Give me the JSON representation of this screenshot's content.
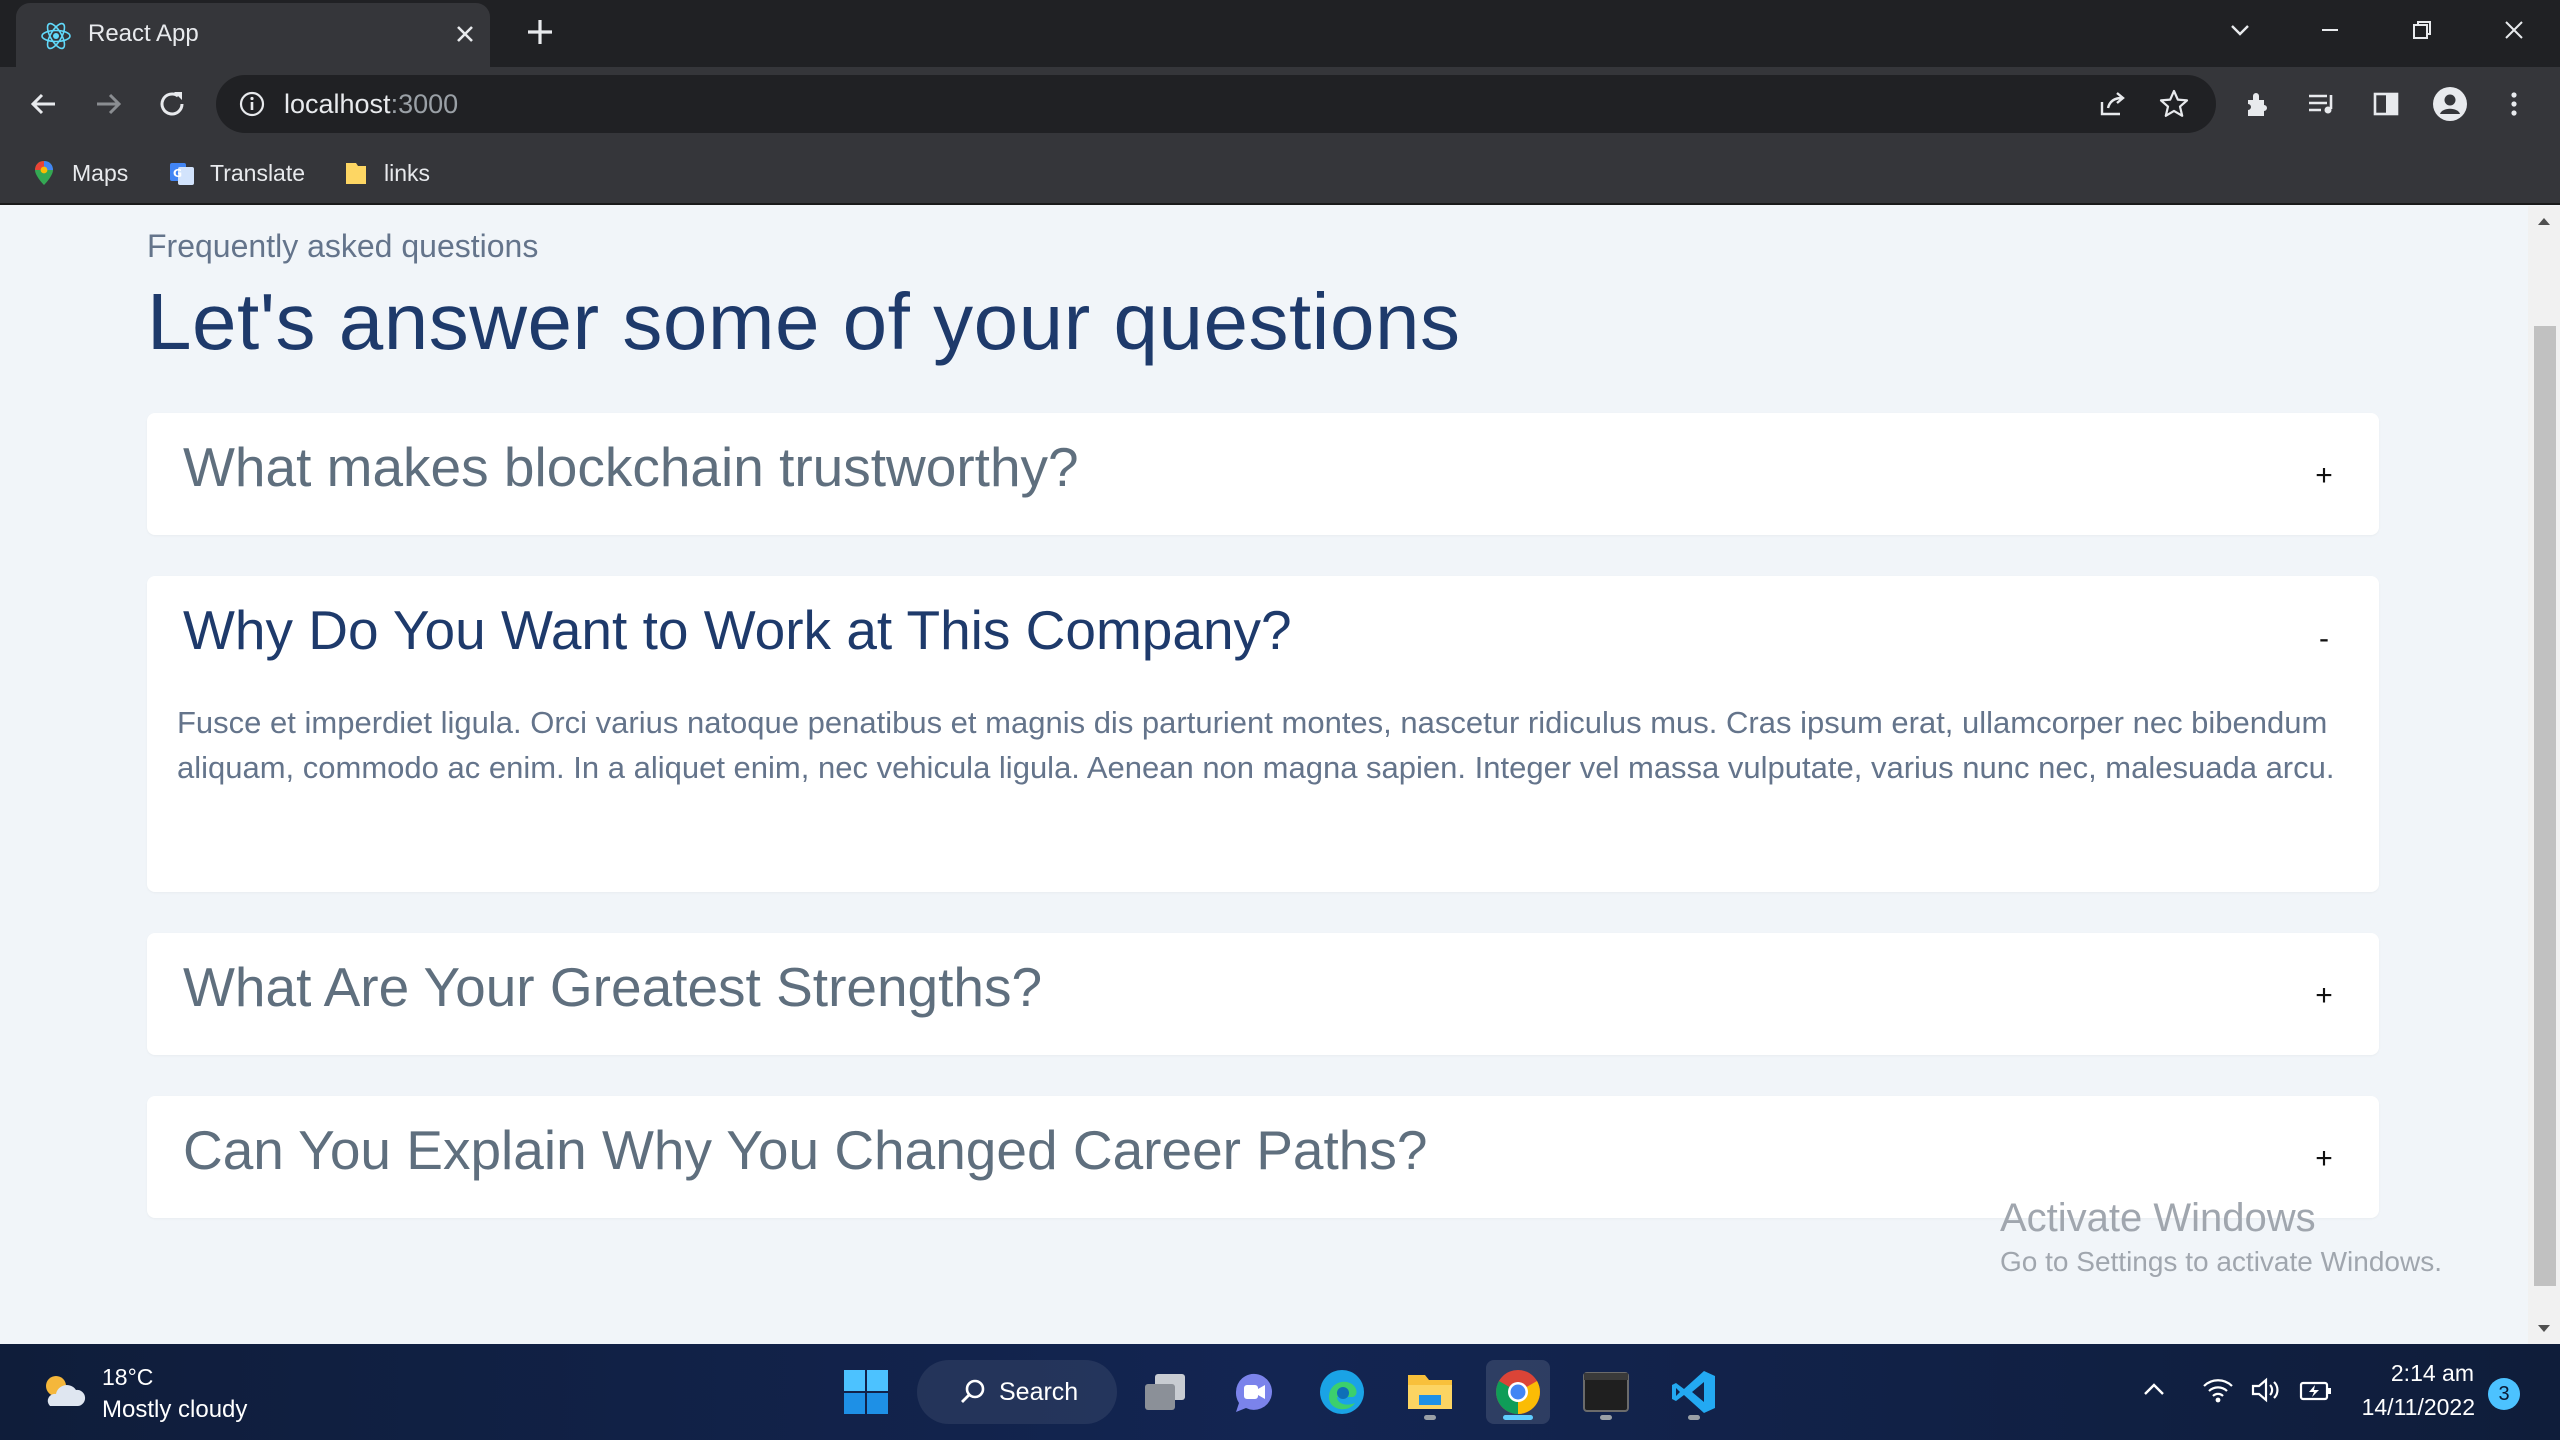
{
  "browser": {
    "tab_title": "React App",
    "url_host": "localhost",
    "url_port": ":3000",
    "bookmarks": [
      {
        "label": "Maps",
        "icon": "maps-icon"
      },
      {
        "label": "Translate",
        "icon": "translate-icon"
      },
      {
        "label": "links",
        "icon": "folder-icon"
      }
    ]
  },
  "faq": {
    "kicker": "Frequently asked questions",
    "title": "Let's answer some of your questions",
    "items": [
      {
        "question": "What makes blockchain trustworthy?",
        "toggle": "+",
        "open": false
      },
      {
        "question": "Why Do You Want to Work at This Company?",
        "toggle": "-",
        "open": true,
        "answer": "Fusce et imperdiet ligula. Orci varius natoque penatibus et magnis dis parturient montes, nascetur ridiculus mus. Cras ipsum erat, ullamcorper nec bibendum aliquam, commodo ac enim. In a aliquet enim, nec vehicula ligula. Aenean non magna sapien. Integer vel massa vulputate, varius nunc nec, malesuada arcu."
      },
      {
        "question": "What Are Your Greatest Strengths?",
        "toggle": "+",
        "open": false
      },
      {
        "question": "Can You Explain Why You Changed Career Paths?",
        "toggle": "+",
        "open": false
      }
    ]
  },
  "watermark": {
    "line1": "Activate Windows",
    "line2": "Go to Settings to activate Windows."
  },
  "taskbar": {
    "weather_temp": "18°C",
    "weather_desc": "Mostly cloudy",
    "search_label": "Search",
    "time": "2:14 am",
    "date": "14/11/2022",
    "notifications": "3"
  },
  "colors": {
    "page_bg": "#f1f5f9",
    "heading": "#1e3a6b",
    "muted": "#64748b",
    "chrome_dark": "#202124",
    "chrome": "#35363a"
  }
}
